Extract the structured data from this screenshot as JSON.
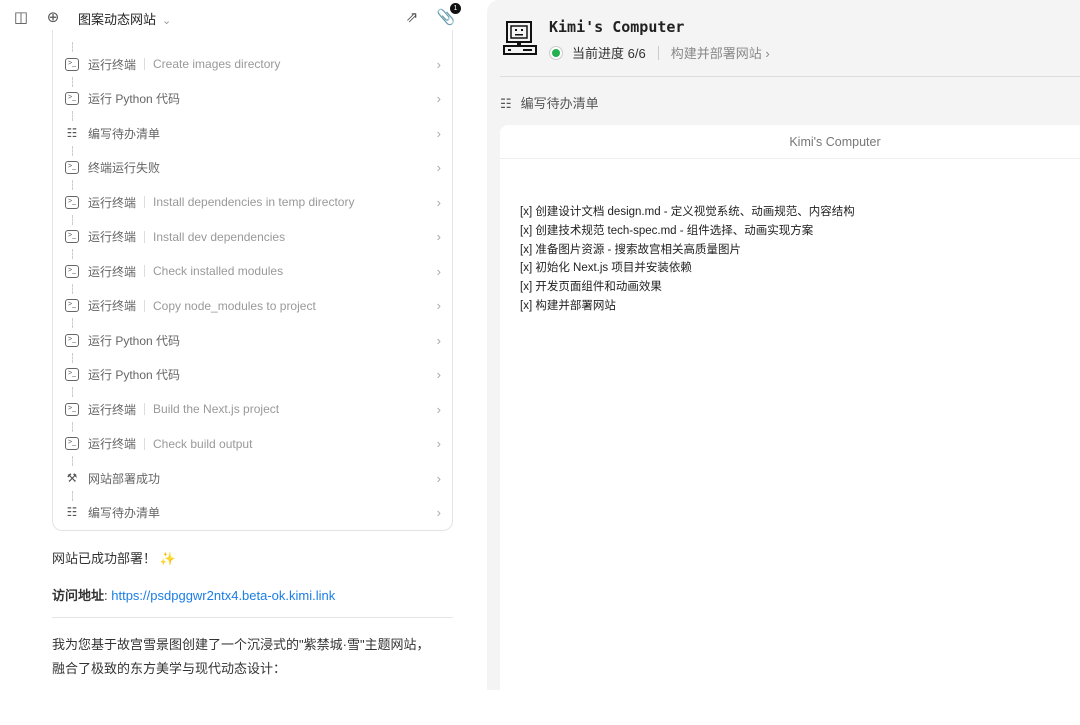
{
  "header": {
    "title": "图案动态网站",
    "attachment_count": "1"
  },
  "steps": [
    {
      "icon": "terminal",
      "label": "运行终端",
      "detail": "Create images directory"
    },
    {
      "icon": "terminal",
      "label": "运行 Python 代码",
      "detail": ""
    },
    {
      "icon": "todo",
      "label": "编写待办清单",
      "detail": ""
    },
    {
      "icon": "terminal",
      "label": "终端运行失败",
      "detail": ""
    },
    {
      "icon": "terminal",
      "label": "运行终端",
      "detail": "Install dependencies in temp directory"
    },
    {
      "icon": "terminal",
      "label": "运行终端",
      "detail": "Install dev dependencies"
    },
    {
      "icon": "terminal",
      "label": "运行终端",
      "detail": "Check installed modules"
    },
    {
      "icon": "terminal",
      "label": "运行终端",
      "detail": "Copy node_modules to project"
    },
    {
      "icon": "terminal",
      "label": "运行 Python 代码",
      "detail": ""
    },
    {
      "icon": "terminal",
      "label": "运行 Python 代码",
      "detail": ""
    },
    {
      "icon": "terminal",
      "label": "运行终端",
      "detail": "Build the Next.js project"
    },
    {
      "icon": "terminal",
      "label": "运行终端",
      "detail": "Check build output"
    },
    {
      "icon": "hammer",
      "label": "网站部署成功",
      "detail": ""
    },
    {
      "icon": "todo",
      "label": "编写待办清单",
      "detail": ""
    }
  ],
  "messages": {
    "deployed": "网站已成功部署！",
    "sparkle": "✨",
    "url_label": "访问地址",
    "url": "https://psdpggwr2ntx4.beta-ok.kimi.link",
    "desc": "我为您基于故宫雪景图创建了一个沉浸式的\"紫禁城·雪\"主题网站，融合了极致的东方美学与现代动态设计："
  },
  "computer": {
    "title": "Kimi's Computer",
    "progress_label": "当前进度 6/6",
    "current_step": "构建并部署网站",
    "tool": "编写待办清单",
    "window_title": "Kimi's Computer",
    "todos": [
      "[x] 创建设计文档 design.md - 定义视觉系统、动画规范、内容结构",
      "[x] 创建技术规范 tech-spec.md - 组件选择、动画实现方案",
      "[x] 准备图片资源 - 搜索故宫相关高质量图片",
      "[x] 初始化 Next.js 项目并安装依赖",
      "[x] 开发页面组件和动画效果",
      "[x] 构建并部署网站"
    ]
  },
  "colors": {
    "accent": "#1a7ee6",
    "status": "#22b14c"
  }
}
